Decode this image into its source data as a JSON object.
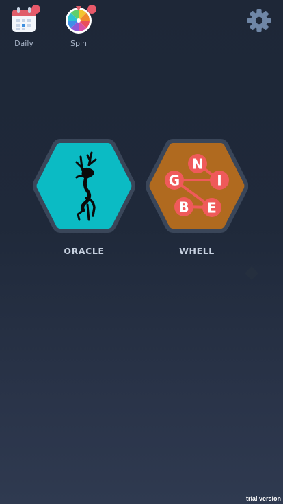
{
  "top_bar": {
    "daily_label": "Daily",
    "spin_label": "Spin"
  },
  "games": [
    {
      "label": "ORACLE"
    },
    {
      "label": "WHELL"
    }
  ],
  "whell_letters": [
    "N",
    "G",
    "I",
    "B",
    "E"
  ],
  "watermark": "trial version",
  "colors": {
    "oracle_tile": "#0bbbc4",
    "whell_tile": "#b06a1f",
    "tile_border": "#3a4659",
    "badge": "#e8596a",
    "letter_circle": "#ef5a5a",
    "gear": "#6f86a6"
  }
}
